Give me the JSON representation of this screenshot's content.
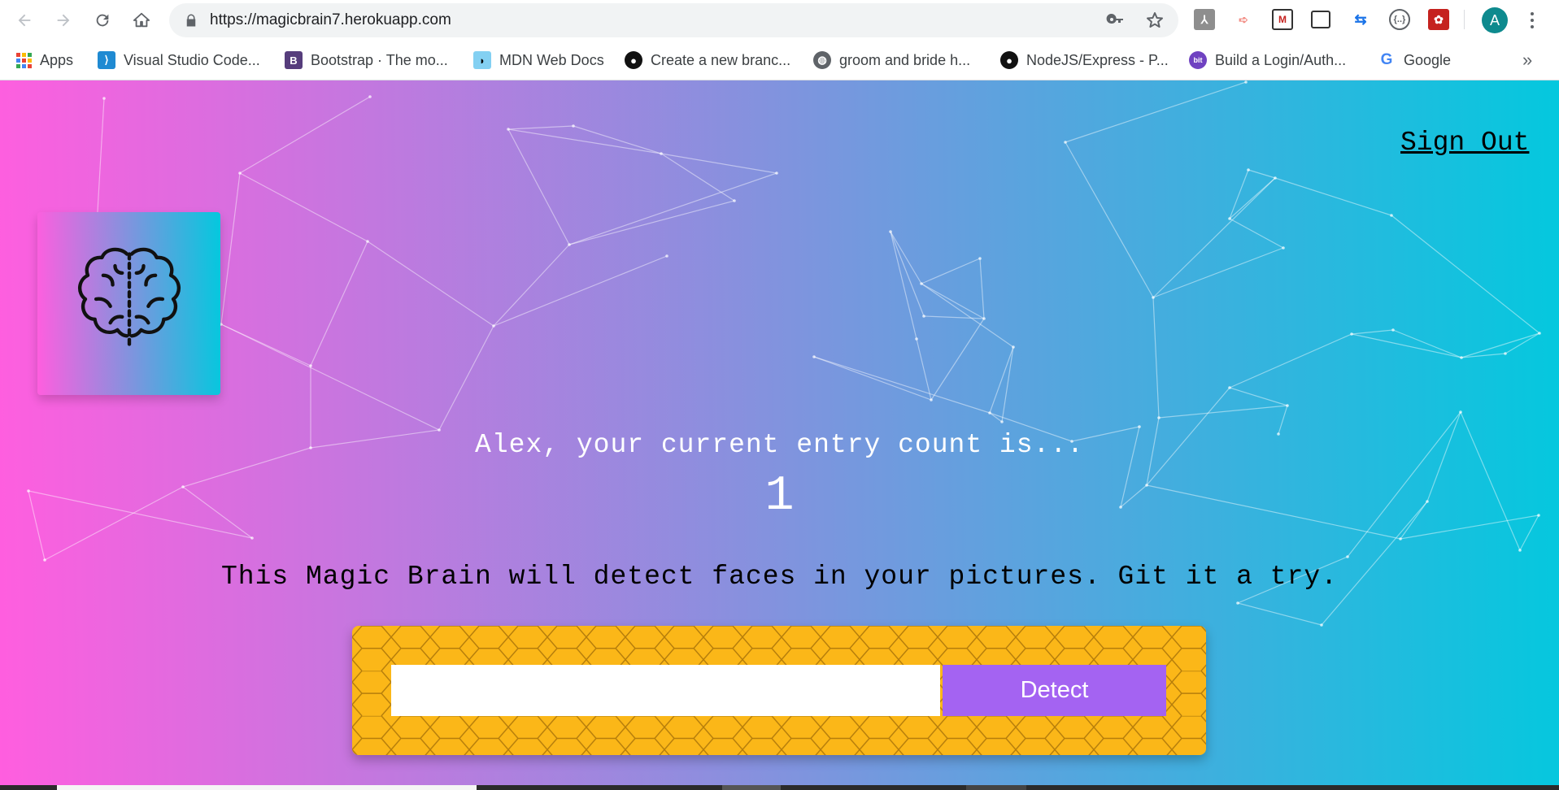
{
  "browser": {
    "url": "https://magicbrain7.herokuapp.com",
    "profile_initial": "A",
    "bookmarks": [
      {
        "label": "Apps",
        "icon": "apps-grid-icon"
      },
      {
        "label": "Visual Studio Code...",
        "icon": "vscode-icon"
      },
      {
        "label": "Bootstrap · The mo...",
        "icon": "bootstrap-icon"
      },
      {
        "label": "MDN Web Docs",
        "icon": "mdn-icon"
      },
      {
        "label": "Create a new branc...",
        "icon": "github-icon"
      },
      {
        "label": "groom and bride h...",
        "icon": "globe-icon"
      },
      {
        "label": "NodeJS/Express - P...",
        "icon": "github-icon"
      },
      {
        "label": "Build a Login/Auth...",
        "icon": "bit-icon"
      },
      {
        "label": "Google",
        "icon": "google-icon"
      }
    ],
    "more_bookmarks": "»"
  },
  "app": {
    "signout_label": "Sign Out",
    "greeting": "Alex, your current entry count is...",
    "entry_count": "1",
    "description": "This Magic Brain will detect faces in your pictures. Git it a try.",
    "input_value": "",
    "detect_label": "Detect"
  },
  "colors": {
    "gradient_start": "#ff5edf",
    "gradient_end": "#04c8de",
    "panel_yellow": "#fbb718",
    "button_purple": "#a463f2"
  }
}
